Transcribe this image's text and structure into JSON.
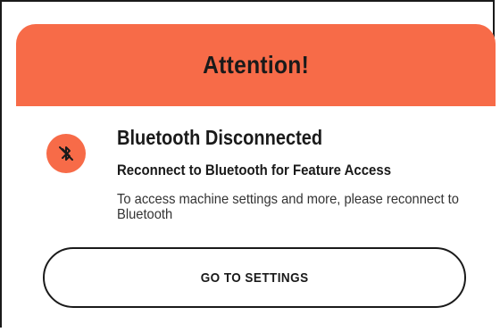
{
  "dialog": {
    "header_title": "Attention!",
    "title": "Bluetooth Disconnected",
    "subtitle": "Reconnect to Bluetooth for Feature Access",
    "body": "To access machine settings and more, please reconnect to Bluetooth",
    "button_label": "GO TO SETTINGS",
    "icon": "bluetooth-disabled-icon"
  },
  "colors": {
    "accent": "#f76b48",
    "text": "#1a1a1a"
  }
}
